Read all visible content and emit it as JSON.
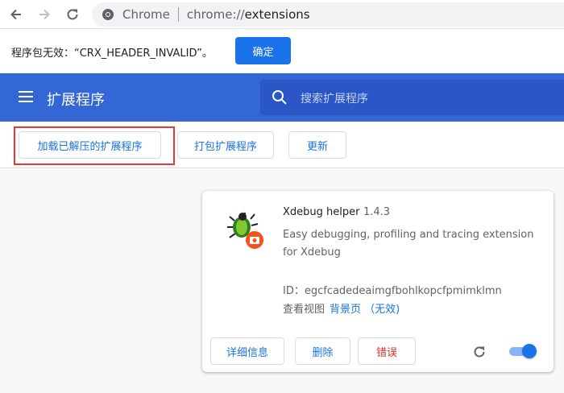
{
  "browser": {
    "site_name": "Chrome",
    "url_scheme": "chrome://",
    "url_host": "extensions"
  },
  "infobar": {
    "message": "程序包无效：“CRX_HEADER_INVALID”。",
    "ok_label": "确定"
  },
  "header": {
    "title": "扩展程序",
    "search_placeholder": "搜索扩展程序"
  },
  "dev_toolbar": {
    "load_unpacked_label": "加载已解压的扩展程序",
    "pack_label": "打包扩展程序",
    "update_label": "更新"
  },
  "extension": {
    "name": "Xdebug helper",
    "version": "1.4.3",
    "description": "Easy debugging, profiling and tracing extension for Xdebug",
    "id_text": "ID：egcfcadedeaimgfbohlkopcfpmimklmn",
    "views_label": "查看视图",
    "views_link": "背景页 （无效)",
    "details_label": "详细信息",
    "remove_label": "删除",
    "errors_label": "错误",
    "enabled": true
  },
  "colors": {
    "header_bg": "#3367d6",
    "accent": "#1a73e8",
    "error": "#d93025",
    "highlight_border": "#e53935"
  },
  "icons": [
    "back-arrow-icon",
    "forward-arrow-icon",
    "reload-icon",
    "chrome-icon",
    "menu-icon",
    "search-icon",
    "xdebug-bug-icon",
    "extension-reload-icon"
  ]
}
